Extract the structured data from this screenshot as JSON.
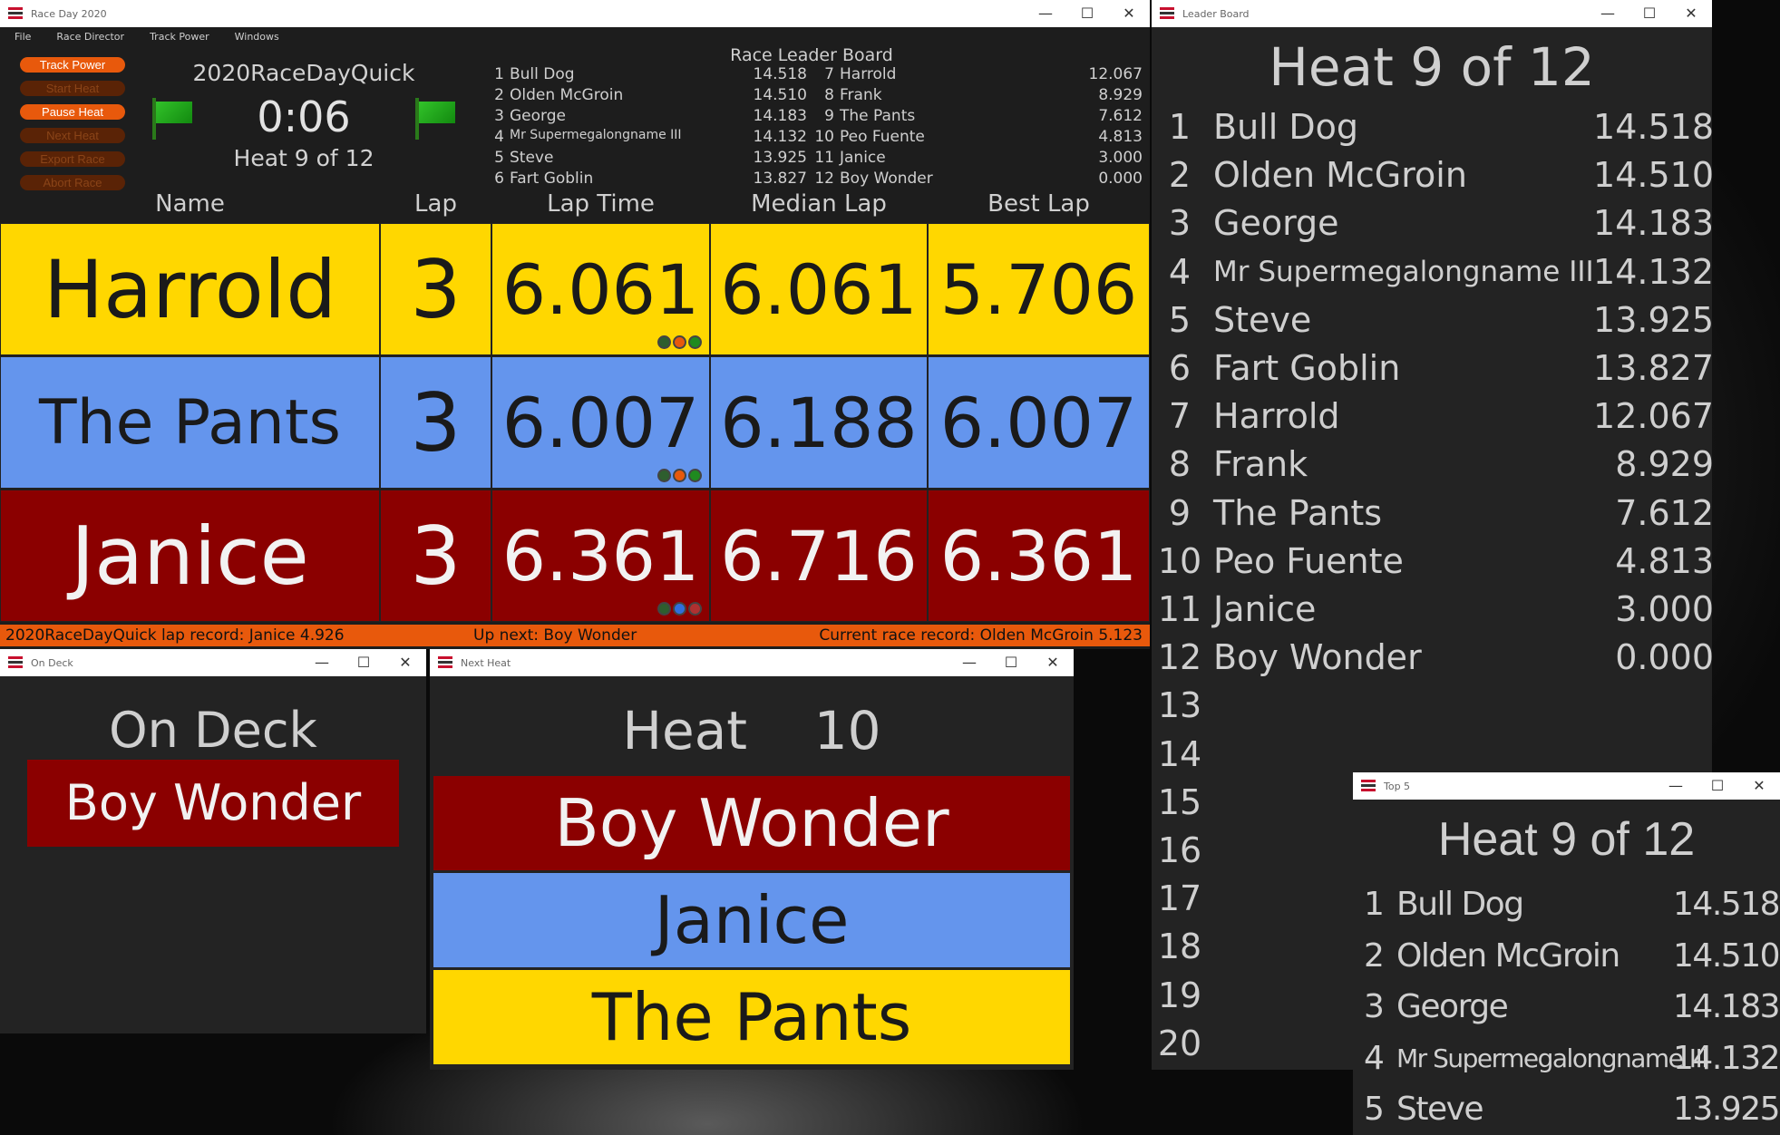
{
  "colors": {
    "lane_yellow": "#FFD700",
    "lane_blue": "#6495ED",
    "lane_red": "#8B0000",
    "accent_orange": "#E8590C",
    "window_bg": "#232323"
  },
  "main_window": {
    "title": "Race Day 2020",
    "menu": [
      "File",
      "Race Director",
      "Track Power",
      "Windows"
    ],
    "buttons": [
      {
        "label": "Track Power",
        "enabled": true
      },
      {
        "label": "Start Heat",
        "enabled": false
      },
      {
        "label": "Pause Heat",
        "enabled": true
      },
      {
        "label": "Next Heat",
        "enabled": false
      },
      {
        "label": "Export Race",
        "enabled": false
      },
      {
        "label": "Abort Race",
        "enabled": false
      }
    ],
    "race_name": "2020RaceDayQuick",
    "clock": "0:06",
    "heat_label": "Heat 9 of 12",
    "leader_board": {
      "title": "Race Leader Board",
      "rows": [
        {
          "pos": "1",
          "name": "Bull Dog",
          "score": "14.518"
        },
        {
          "pos": "2",
          "name": "Olden McGroin",
          "score": "14.510"
        },
        {
          "pos": "3",
          "name": "George",
          "score": "14.183"
        },
        {
          "pos": "4",
          "name": "Mr Supermegalongname III",
          "score": "14.132"
        },
        {
          "pos": "5",
          "name": "Steve",
          "score": "13.925"
        },
        {
          "pos": "6",
          "name": "Fart Goblin",
          "score": "13.827"
        },
        {
          "pos": "7",
          "name": "Harrold",
          "score": "12.067"
        },
        {
          "pos": "8",
          "name": "Frank",
          "score": "8.929"
        },
        {
          "pos": "9",
          "name": "The Pants",
          "score": "7.612"
        },
        {
          "pos": "10",
          "name": "Peo Fuente",
          "score": "4.813"
        },
        {
          "pos": "11",
          "name": "Janice",
          "score": "3.000"
        },
        {
          "pos": "12",
          "name": "Boy Wonder",
          "score": "0.000"
        }
      ]
    },
    "columns": [
      "Name",
      "Lap",
      "Lap Time",
      "Median Lap",
      "Best Lap"
    ],
    "lanes": [
      {
        "name": "Harrold",
        "lap": "3",
        "lap_time": "6.061",
        "median_lap": "6.061",
        "best_lap": "5.706",
        "color": "#FFD700",
        "text_color": "#1a1a1a",
        "badges": [
          "#2e5e2e",
          "#e8590c",
          "#1f8a1f"
        ]
      },
      {
        "name": "The Pants",
        "lap": "3",
        "lap_time": "6.007",
        "median_lap": "6.188",
        "best_lap": "6.007",
        "color": "#6495ED",
        "text_color": "#1a1a1a",
        "badges": [
          "#2e5e2e",
          "#e8590c",
          "#1f8a1f"
        ]
      },
      {
        "name": "Janice",
        "lap": "3",
        "lap_time": "6.361",
        "median_lap": "6.716",
        "best_lap": "6.361",
        "color": "#8B0000",
        "text_color": "#f2f2f2",
        "badges": [
          "#2e5e2e",
          "#2f6fdc",
          "#b03030"
        ]
      }
    ],
    "status": {
      "lap_record": "2020RaceDayQuick lap record:  Janice  4.926",
      "up_next": "Up next:  Boy Wonder",
      "race_record": "Current race record:  Olden McGroin  5.123"
    }
  },
  "leader_window": {
    "title": "Leader Board",
    "heading": "Heat 9 of 12",
    "rows": [
      {
        "pos": "1",
        "name": "Bull Dog",
        "score": "14.518"
      },
      {
        "pos": "2",
        "name": "Olden McGroin",
        "score": "14.510"
      },
      {
        "pos": "3",
        "name": "George",
        "score": "14.183"
      },
      {
        "pos": "4",
        "name": "Mr Supermegalongname III",
        "score": "14.132"
      },
      {
        "pos": "5",
        "name": "Steve",
        "score": "13.925"
      },
      {
        "pos": "6",
        "name": "Fart Goblin",
        "score": "13.827"
      },
      {
        "pos": "7",
        "name": "Harrold",
        "score": "12.067"
      },
      {
        "pos": "8",
        "name": "Frank",
        "score": "8.929"
      },
      {
        "pos": "9",
        "name": "The Pants",
        "score": "7.612"
      },
      {
        "pos": "10",
        "name": "Peo Fuente",
        "score": "4.813"
      },
      {
        "pos": "11",
        "name": "Janice",
        "score": "3.000"
      },
      {
        "pos": "12",
        "name": "Boy Wonder",
        "score": "0.000"
      },
      {
        "pos": "13",
        "name": "",
        "score": ""
      },
      {
        "pos": "14",
        "name": "",
        "score": ""
      },
      {
        "pos": "15",
        "name": "",
        "score": ""
      },
      {
        "pos": "16",
        "name": "",
        "score": ""
      },
      {
        "pos": "17",
        "name": "",
        "score": ""
      },
      {
        "pos": "18",
        "name": "",
        "score": ""
      },
      {
        "pos": "19",
        "name": "",
        "score": ""
      },
      {
        "pos": "20",
        "name": "",
        "score": ""
      }
    ]
  },
  "ondeck_window": {
    "title": "On Deck",
    "heading": "On Deck",
    "racer": "Boy Wonder"
  },
  "nextheat_window": {
    "title": "Next Heat",
    "heading": "Heat    10",
    "lanes": [
      {
        "name": "Boy Wonder",
        "color": "#8B0000",
        "text_color": "#f2f2f2"
      },
      {
        "name": "Janice",
        "color": "#6495ED",
        "text_color": "#1a1a1a"
      },
      {
        "name": "The Pants",
        "color": "#FFD700",
        "text_color": "#1a1a1a"
      }
    ]
  },
  "top5_window": {
    "title": "Top 5",
    "heading": "Heat 9 of 12",
    "rows": [
      {
        "pos": "1",
        "name": "Bull Dog",
        "score": "14.518"
      },
      {
        "pos": "2",
        "name": "Olden McGroin",
        "score": "14.510"
      },
      {
        "pos": "3",
        "name": "George",
        "score": "14.183"
      },
      {
        "pos": "4",
        "name": "Mr Supermegalongname III",
        "score": "14.132"
      },
      {
        "pos": "5",
        "name": "Steve",
        "score": "13.925"
      }
    ]
  },
  "window_controls": {
    "minimize": "—",
    "maximize": "☐",
    "close": "✕"
  }
}
